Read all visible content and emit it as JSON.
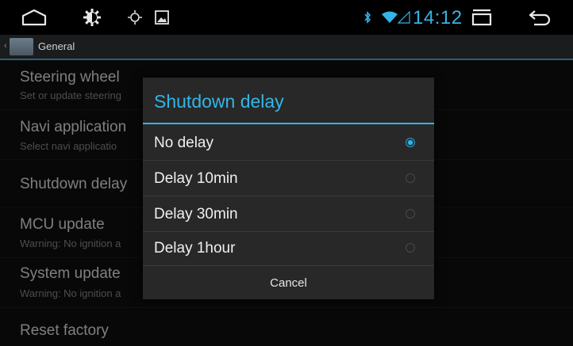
{
  "statusbar": {
    "icons": [
      "home-outline-icon",
      "settings-gear-icon",
      "brightness-icon",
      "image-icon",
      "bluetooth-icon",
      "wifi-icon",
      "signal-icon",
      "recent-apps-icon",
      "back-arrow-icon"
    ],
    "time": "14:12",
    "accent": "#33b5e5"
  },
  "actionbar": {
    "title": "General"
  },
  "settings_list": [
    {
      "title": "Steering wheel",
      "subtitle": "Set or update steering"
    },
    {
      "title": "Navi application",
      "subtitle": "Select navi applicatio"
    },
    {
      "title": "Shutdown delay",
      "subtitle": ""
    },
    {
      "title": "MCU update",
      "subtitle": "Warning: No ignition a"
    },
    {
      "title": "System update",
      "subtitle": "Warning: No ignition a"
    },
    {
      "title": "Reset factory",
      "subtitle": ""
    }
  ],
  "dialog": {
    "title": "Shutdown delay",
    "options": [
      {
        "label": "No delay",
        "selected": true
      },
      {
        "label": "Delay 10min",
        "selected": false
      },
      {
        "label": "Delay 30min",
        "selected": false
      },
      {
        "label": "Delay 1hour",
        "selected": false
      }
    ],
    "cancel_label": "Cancel"
  }
}
